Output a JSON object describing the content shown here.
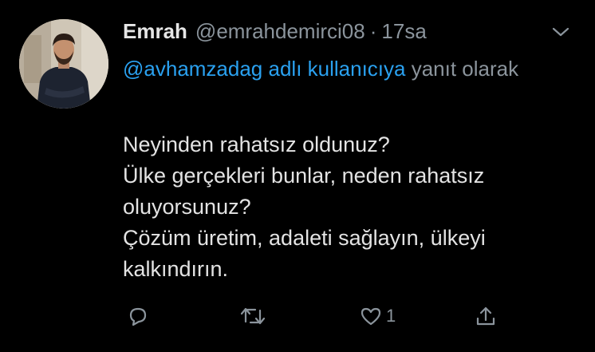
{
  "tweet": {
    "author_name": "Emrah",
    "handle": "@emrahdemirci08",
    "separator": "·",
    "time": "17sa",
    "reply_to_handle": "@avhamzadag adlı kullanıcıya",
    "reply_suffix": " yanıt olarak",
    "text": "Neyinden rahatsız oldunuz?\nÜlke gerçekleri bunlar, neden rahatsız oluyorsunuz?\nÇözüm üretim, adaleti sağlayın, ülkeyi kalkındırın.",
    "like_count": "1"
  },
  "icons": {
    "more": "chevron-down-icon",
    "reply": "reply-icon",
    "retweet": "retweet-icon",
    "like": "heart-icon",
    "share": "share-icon"
  },
  "colors": {
    "background": "#000000",
    "text": "#e3e3e3",
    "muted": "#8b949c",
    "link": "#2aa1f0"
  }
}
